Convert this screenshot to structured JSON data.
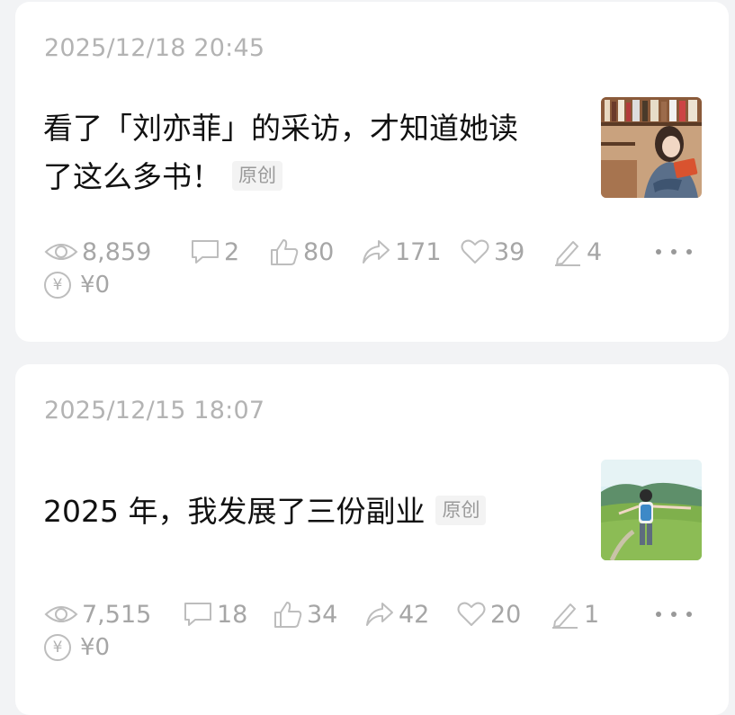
{
  "articles": [
    {
      "date": "2025/12/18 20:45",
      "title": "看了「刘亦菲」的采访，才知道她读了这么多书！",
      "tag": "原创",
      "stats": {
        "views": "8,859",
        "comments": "2",
        "likes": "80",
        "shares": "171",
        "favorites": "39",
        "edits": "4"
      },
      "income": "¥0"
    },
    {
      "date": "2025/12/15 18:07",
      "title": "2025 年，我发展了三份副业",
      "tag": "原创",
      "stats": {
        "views": "7,515",
        "comments": "18",
        "likes": "34",
        "shares": "42",
        "favorites": "20",
        "edits": "1"
      },
      "income": "¥0"
    }
  ],
  "icons": {
    "views": "eye-icon",
    "comments": "comment-icon",
    "likes": "thumbs-up-icon",
    "shares": "share-icon",
    "favorites": "heart-icon",
    "edits": "pencil-icon",
    "income": "yen-icon",
    "more": "more-icon"
  },
  "colors": {
    "page_background": "#f2f3f5",
    "card_background": "#ffffff",
    "meta_text": "#a6a6a6",
    "title_text": "#111111"
  }
}
